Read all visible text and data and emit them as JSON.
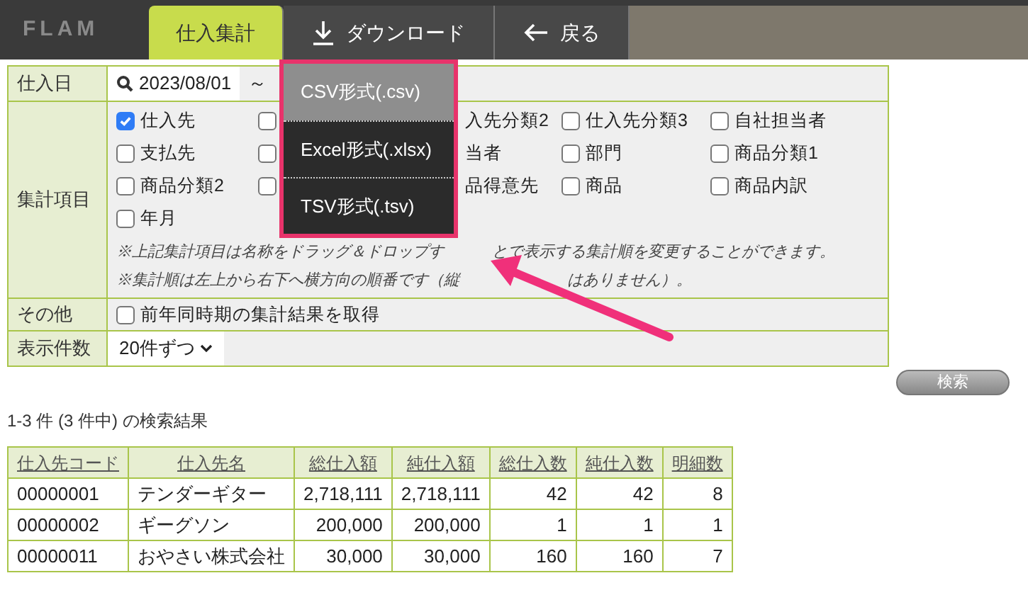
{
  "nav": {
    "logo": "FLAM",
    "tabs": [
      {
        "label": "仕入集計",
        "selected": true
      },
      {
        "label": "ダウンロード",
        "selected": false
      },
      {
        "label": "戻る",
        "selected": false
      }
    ]
  },
  "download_menu": [
    {
      "label": "CSV形式(.csv)",
      "selected": true
    },
    {
      "label": "Excel形式(.xlsx)",
      "selected": false
    },
    {
      "label": "TSV形式(.tsv)",
      "selected": false
    }
  ],
  "form": {
    "date_label": "仕入日",
    "date_from": "2023/08/01",
    "date_sep": "～",
    "items_label": "集計項目",
    "items": [
      {
        "kind": "checkbox",
        "label": "仕入先",
        "checked": true
      },
      {
        "kind": "checkbox",
        "checked": false
      },
      {
        "kind": "clipped",
        "label": "入先分類2"
      },
      {
        "kind": "checkbox",
        "label": "仕入先分類3",
        "checked": false
      },
      {
        "kind": "checkbox",
        "label": "自社担当者",
        "checked": false
      },
      {
        "kind": "checkbox",
        "label": "支払先",
        "checked": false
      },
      {
        "kind": "checkbox",
        "checked": false
      },
      {
        "kind": "clipped",
        "label": "当者"
      },
      {
        "kind": "checkbox",
        "label": "部門",
        "checked": false
      },
      {
        "kind": "checkbox",
        "label": "商品分類1",
        "checked": false
      },
      {
        "kind": "checkbox",
        "label": "商品分類2",
        "checked": false
      },
      {
        "kind": "checkbox",
        "checked": false
      },
      {
        "kind": "clipped",
        "label": "品得意先"
      },
      {
        "kind": "checkbox",
        "label": "商品",
        "checked": false
      },
      {
        "kind": "checkbox",
        "label": "商品内訳",
        "checked": false
      },
      {
        "kind": "checkbox",
        "label": "年月",
        "checked": false
      }
    ],
    "notes": [
      [
        "※上記集計項目は名称をドラッグ＆ドロップす",
        "とで表示する集計順を変更することができます。"
      ],
      [
        "※集計順は左上から右下へ横方向の順番です（縦",
        "はありません）。"
      ]
    ],
    "other_label": "その他",
    "other_option": {
      "label": "前年同時期の集計結果を取得",
      "checked": false
    },
    "count_label": "表示件数",
    "count_value": "20件ずつ",
    "search_button": "検索"
  },
  "results": {
    "summary": "1-3 件 (3 件中) の検索結果",
    "columns": [
      "仕入先コード",
      "仕入先名",
      "総仕入額",
      "純仕入額",
      "総仕入数",
      "純仕入数",
      "明細数"
    ],
    "rows": [
      [
        "00000001",
        "テンダーギター",
        "2,718,111",
        "2,718,111",
        "42",
        "42",
        "8"
      ],
      [
        "00000002",
        "ギーグソン",
        "200,000",
        "200,000",
        "1",
        "1",
        "1"
      ],
      [
        "00000011",
        "おやさい株式会社",
        "30,000",
        "30,000",
        "160",
        "160",
        "7"
      ]
    ]
  }
}
